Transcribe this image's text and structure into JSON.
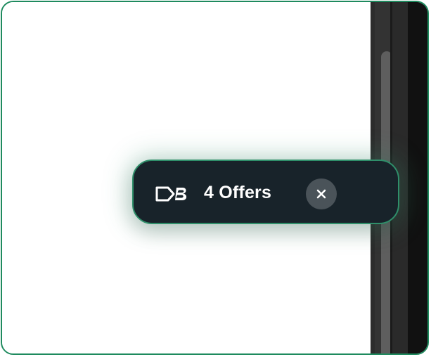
{
  "offers_widget": {
    "label": "4 Offers",
    "logo_icon": "db-tag-logo-icon",
    "close_icon": "close-icon",
    "accent_color": "#2f8f6a",
    "background_color": "#18232a"
  },
  "frame": {
    "border_color": "#1e8a5e"
  }
}
